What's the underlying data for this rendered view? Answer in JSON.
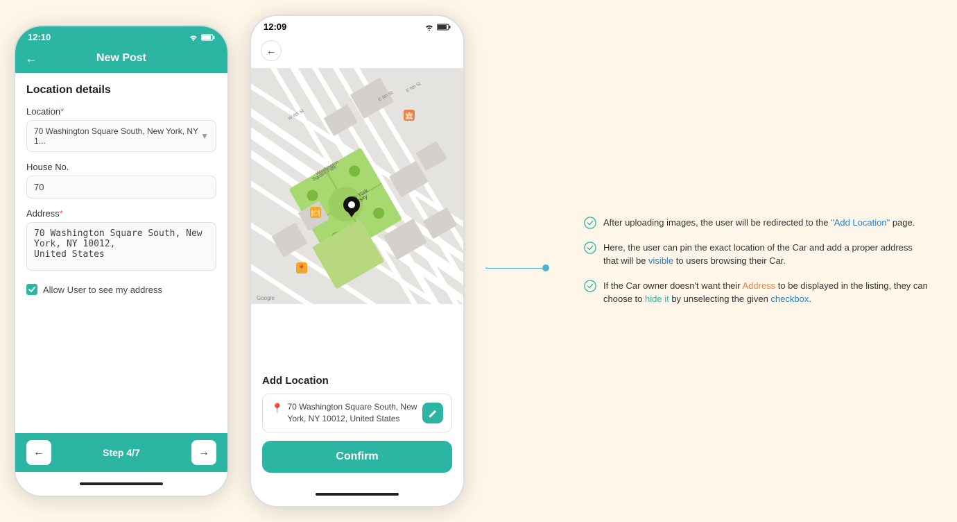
{
  "phone1": {
    "status_bar": {
      "time": "12:10",
      "icons": "wifi battery"
    },
    "header": {
      "back_label": "←",
      "title": "New Post"
    },
    "body": {
      "section_title": "Location details",
      "location_label": "Location",
      "location_value": "70 Washington Square South, New York, NY 1...",
      "house_no_label": "House No.",
      "house_no_value": "70",
      "address_label": "Address",
      "address_value": "70 Washington Square South, New York, NY 10012, United States",
      "checkbox_label": "Allow User to see my address"
    },
    "footer": {
      "back_label": "←",
      "step_label": "Step 4/7",
      "next_label": "→"
    }
  },
  "phone2": {
    "status_bar": {
      "time": "12:09"
    },
    "add_location": {
      "title": "Add Location",
      "address": "70 Washington Square South, New York, NY 10012, United States",
      "confirm_btn": "Confirm"
    }
  },
  "annotations": {
    "note1": "After uploading images, the user will be redirected to the \"Add Location\" page.",
    "note2": "Here, the user can pin the exact location of the Car and add a proper address that will be visible to users browsing their Car.",
    "note3": "If the Car owner doesn't want their Address to be displayed in the listing, they can choose to hide it by unselecting the given checkbox.",
    "highlight_add_location": "Add Location",
    "highlight_visible": "visible",
    "highlight_address": "Address",
    "highlight_hide": "hide it",
    "highlight_checkbox": "checkbox"
  }
}
